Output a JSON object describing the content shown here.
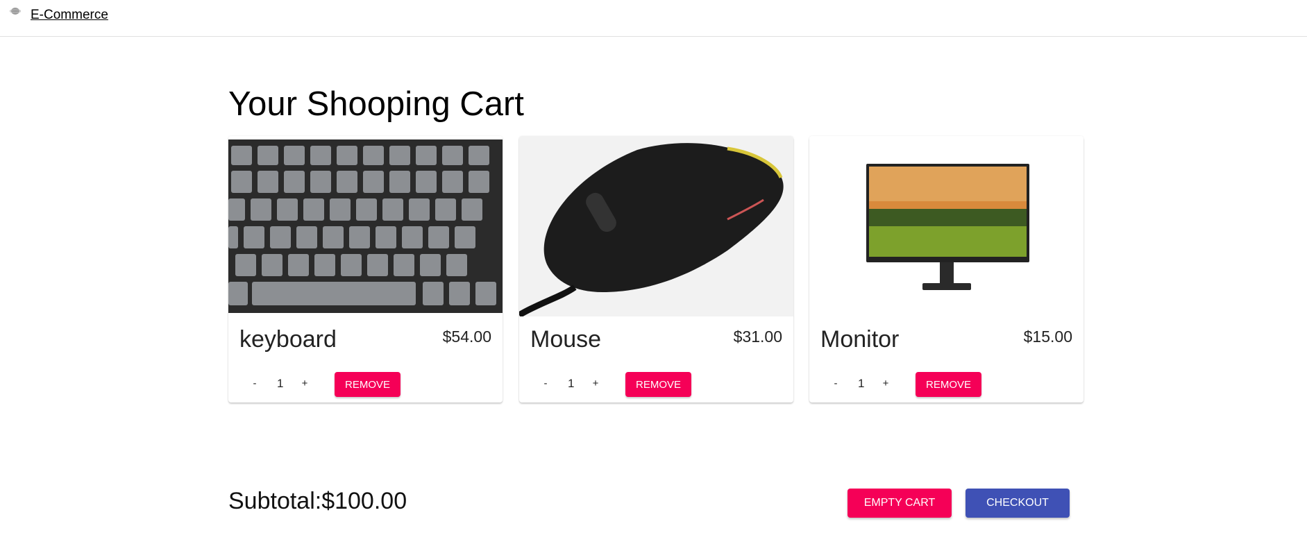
{
  "header": {
    "logo_icon": "planet-logo-icon",
    "brand": "E-Commerce"
  },
  "page": {
    "title": "Your Shooping Cart"
  },
  "cart": {
    "items": [
      {
        "name": "keyboard",
        "price": "$54.00",
        "quantity": "1",
        "minus": "-",
        "plus": "+",
        "remove": "REMOVE",
        "image": "keyboard-image"
      },
      {
        "name": "Mouse",
        "price": "$31.00",
        "quantity": "1",
        "minus": "-",
        "plus": "+",
        "remove": "REMOVE",
        "image": "mouse-image"
      },
      {
        "name": "Monitor",
        "price": "$15.00",
        "quantity": "1",
        "minus": "-",
        "plus": "+",
        "remove": "REMOVE",
        "image": "monitor-image"
      }
    ]
  },
  "summary": {
    "subtotal": "Subtotal:$100.00",
    "empty_cart": "EMPTY CART",
    "checkout": "CHECKOUT"
  },
  "colors": {
    "secondary": "#f50057",
    "primary": "#3f51b5"
  }
}
